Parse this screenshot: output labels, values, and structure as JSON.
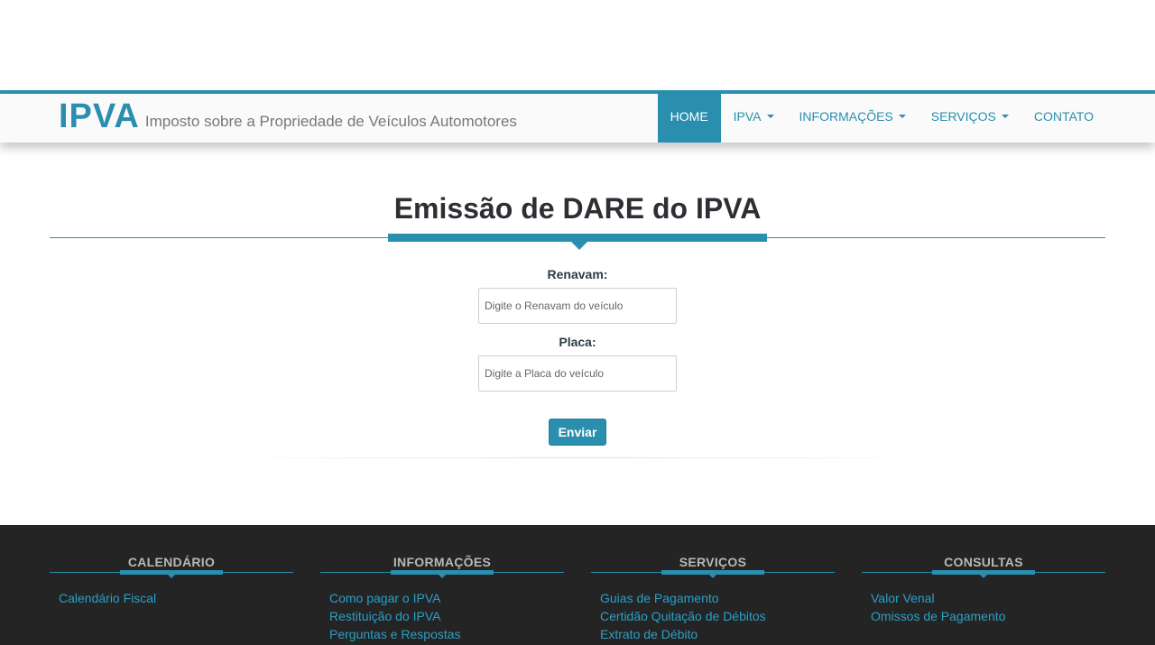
{
  "header": {
    "logo": "IPVA",
    "subtitle": "Imposto sobre a Propriedade de Veículos Automotores",
    "nav": [
      {
        "label": "HOME",
        "active": true,
        "dropdown": false
      },
      {
        "label": "IPVA",
        "active": false,
        "dropdown": true
      },
      {
        "label": "INFORMAÇÕES",
        "active": false,
        "dropdown": true
      },
      {
        "label": "SERVIÇOS",
        "active": false,
        "dropdown": true
      },
      {
        "label": "CONTATO",
        "active": false,
        "dropdown": false
      }
    ]
  },
  "main": {
    "title": "Emissão de DARE do IPVA",
    "form": {
      "renavam_label": "Renavam:",
      "renavam_placeholder": "Digite o Renavam do veículo",
      "renavam_value": "",
      "placa_label": "Placa:",
      "placa_placeholder": "Digite a Placa do veículo",
      "placa_value": "",
      "submit_label": "Enviar"
    }
  },
  "footer": {
    "columns": [
      {
        "heading": "CALENDÁRIO",
        "links": [
          "Calendário Fiscal"
        ]
      },
      {
        "heading": "INFORMAÇÕES",
        "links": [
          "Como pagar o IPVA",
          "Restituição do IPVA",
          "Perguntas e Respostas"
        ]
      },
      {
        "heading": "SERVIÇOS",
        "links": [
          "Guias de Pagamento",
          "Certidão Quitação de Débitos",
          "Extrato de Débito"
        ]
      },
      {
        "heading": "CONSULTAS",
        "links": [
          "Valor Venal",
          "Omissos de Pagamento"
        ]
      }
    ]
  },
  "colors": {
    "accent": "#2a8faf",
    "footer_bg": "#242424",
    "footer_link": "#2a9fc7",
    "title_text": "#2c2f33"
  }
}
